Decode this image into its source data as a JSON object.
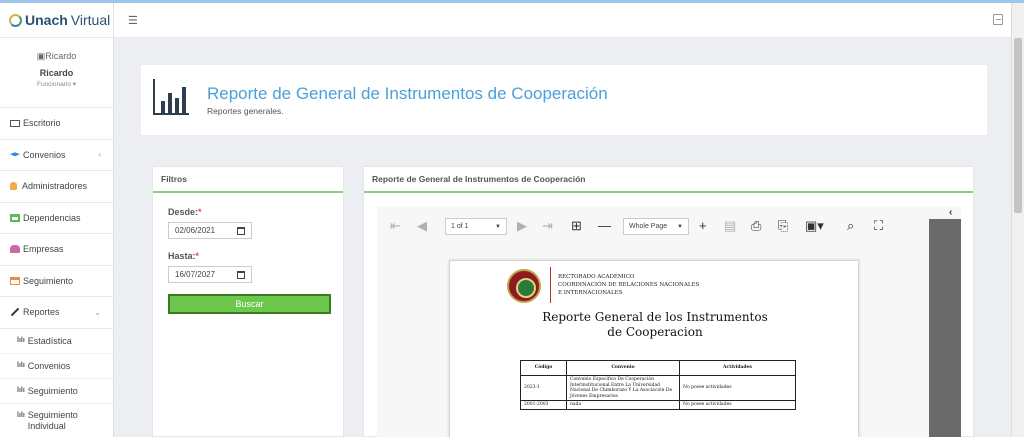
{
  "brand": {
    "name_bold": "Unach",
    "name_rest": "Virtual"
  },
  "user": {
    "picture_alt": "Ricardo",
    "name": "Ricardo",
    "role": "Funcionario ▾"
  },
  "sidebar": {
    "items": [
      {
        "label": "Escritorio",
        "icon": "desktop-icon",
        "color": "#555555"
      },
      {
        "label": "Convenios",
        "icon": "graduation-cap-icon",
        "color": "#2f8bd6",
        "chevron": "‹"
      },
      {
        "label": "Administradores",
        "icon": "user-icon",
        "color": "#f0ad4e"
      },
      {
        "label": "Dependencias",
        "icon": "bank-icon",
        "color": "#5cb85c"
      },
      {
        "label": "Empresas",
        "icon": "users-icon",
        "color": "#c86aaa"
      },
      {
        "label": "Seguimiento",
        "icon": "list-icon",
        "color": "#f0883e"
      },
      {
        "label": "Reportes",
        "icon": "wrench-icon",
        "color": "#333333",
        "chevron": "⌄"
      }
    ],
    "sub_items": [
      {
        "label": "Estadística"
      },
      {
        "label": "Convenios"
      },
      {
        "label": "Seguimiento"
      },
      {
        "label": "Seguimiento Individual"
      }
    ]
  },
  "header": {
    "menu_icon": "☰"
  },
  "title": {
    "main": "Reporte de General de Instrumentos de Cooperación",
    "sub": "Reportes generales."
  },
  "filters": {
    "heading": "Filtros",
    "desde_label": "Desde:",
    "desde_value": "02/06/2021",
    "hasta_label": "Hasta:",
    "hasta_value": "16/07/2027",
    "required_mark": "*",
    "button": "Buscar"
  },
  "report": {
    "heading": "Reporte de General de Instrumentos de Cooperación",
    "viewer": {
      "page_select": "1 of 1",
      "zoom_select": "Whole Page"
    },
    "pdf": {
      "org_line1": "RECTORADO ACADÉMICO",
      "org_line2": "COORDINACIÓN DE RELACIONES NACIONALES",
      "org_line3": "E INTERNACIONALES",
      "title_line1": "Reporte General de los Instrumentos",
      "title_line2": "de Cooperacion",
      "columns": [
        "Código",
        "Convenio",
        "Actividades"
      ],
      "rows": [
        [
          "2023-1",
          "Convenio Específico De Cooperación Interinstitucional Entre La Universidad Nacional De Chimborazo Y La Asociación De Jóvenes Empresarios",
          "No posee actividades"
        ],
        [
          "2001-2003",
          "nada",
          "No posee actividades"
        ]
      ]
    }
  }
}
